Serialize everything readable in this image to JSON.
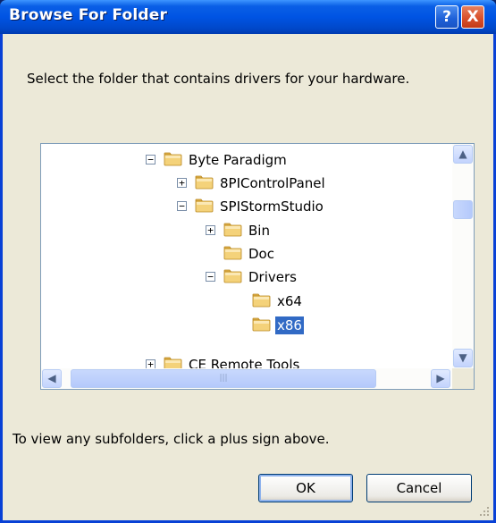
{
  "window": {
    "title": "Browse For Folder"
  },
  "title_buttons": {
    "help": "?",
    "close": "X"
  },
  "dialog": {
    "prompt": "Select the folder that contains drivers for your hardware.",
    "hint": "To view any subfolders, click a plus sign above."
  },
  "tree": {
    "nodes": [
      {
        "label": "Byte Paradigm",
        "expander": "−",
        "selected": false
      },
      {
        "label": "8PIControlPanel",
        "expander": "+",
        "selected": false
      },
      {
        "label": "SPIStormStudio",
        "expander": "−",
        "selected": false
      },
      {
        "label": "Bin",
        "expander": "+",
        "selected": false
      },
      {
        "label": "Doc",
        "expander": "",
        "selected": false
      },
      {
        "label": "Drivers",
        "expander": "−",
        "selected": false
      },
      {
        "label": "x64",
        "expander": "",
        "selected": false
      },
      {
        "label": "x86",
        "expander": "",
        "selected": true
      },
      {
        "label": "CE Remote Tools",
        "expander": "+",
        "selected": false
      }
    ]
  },
  "scrollbars": {
    "up_arrow": "▲",
    "down_arrow": "▼",
    "left_arrow": "◀",
    "right_arrow": "▶",
    "grip": "|||"
  },
  "buttons": {
    "ok": "OK",
    "cancel": "Cancel"
  },
  "colors": {
    "title_bar": "#0054e3",
    "dialog_face": "#ece9d8",
    "selection": "#316ac5",
    "folder": "#f4d27a"
  }
}
